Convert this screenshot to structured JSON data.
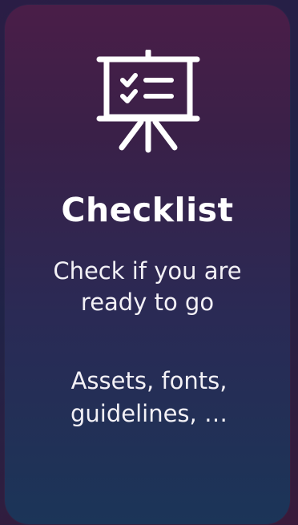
{
  "card": {
    "icon": "presentation-checklist-icon",
    "title": "Checklist",
    "subtitle_lines": [
      "Check if you are",
      "ready to go"
    ],
    "detail_lines": [
      "Assets, fonts,",
      "guidelines, …"
    ]
  },
  "colors": {
    "text": "#ffffff",
    "card_top": "#4a1e48",
    "card_bottom": "#1b3558"
  }
}
